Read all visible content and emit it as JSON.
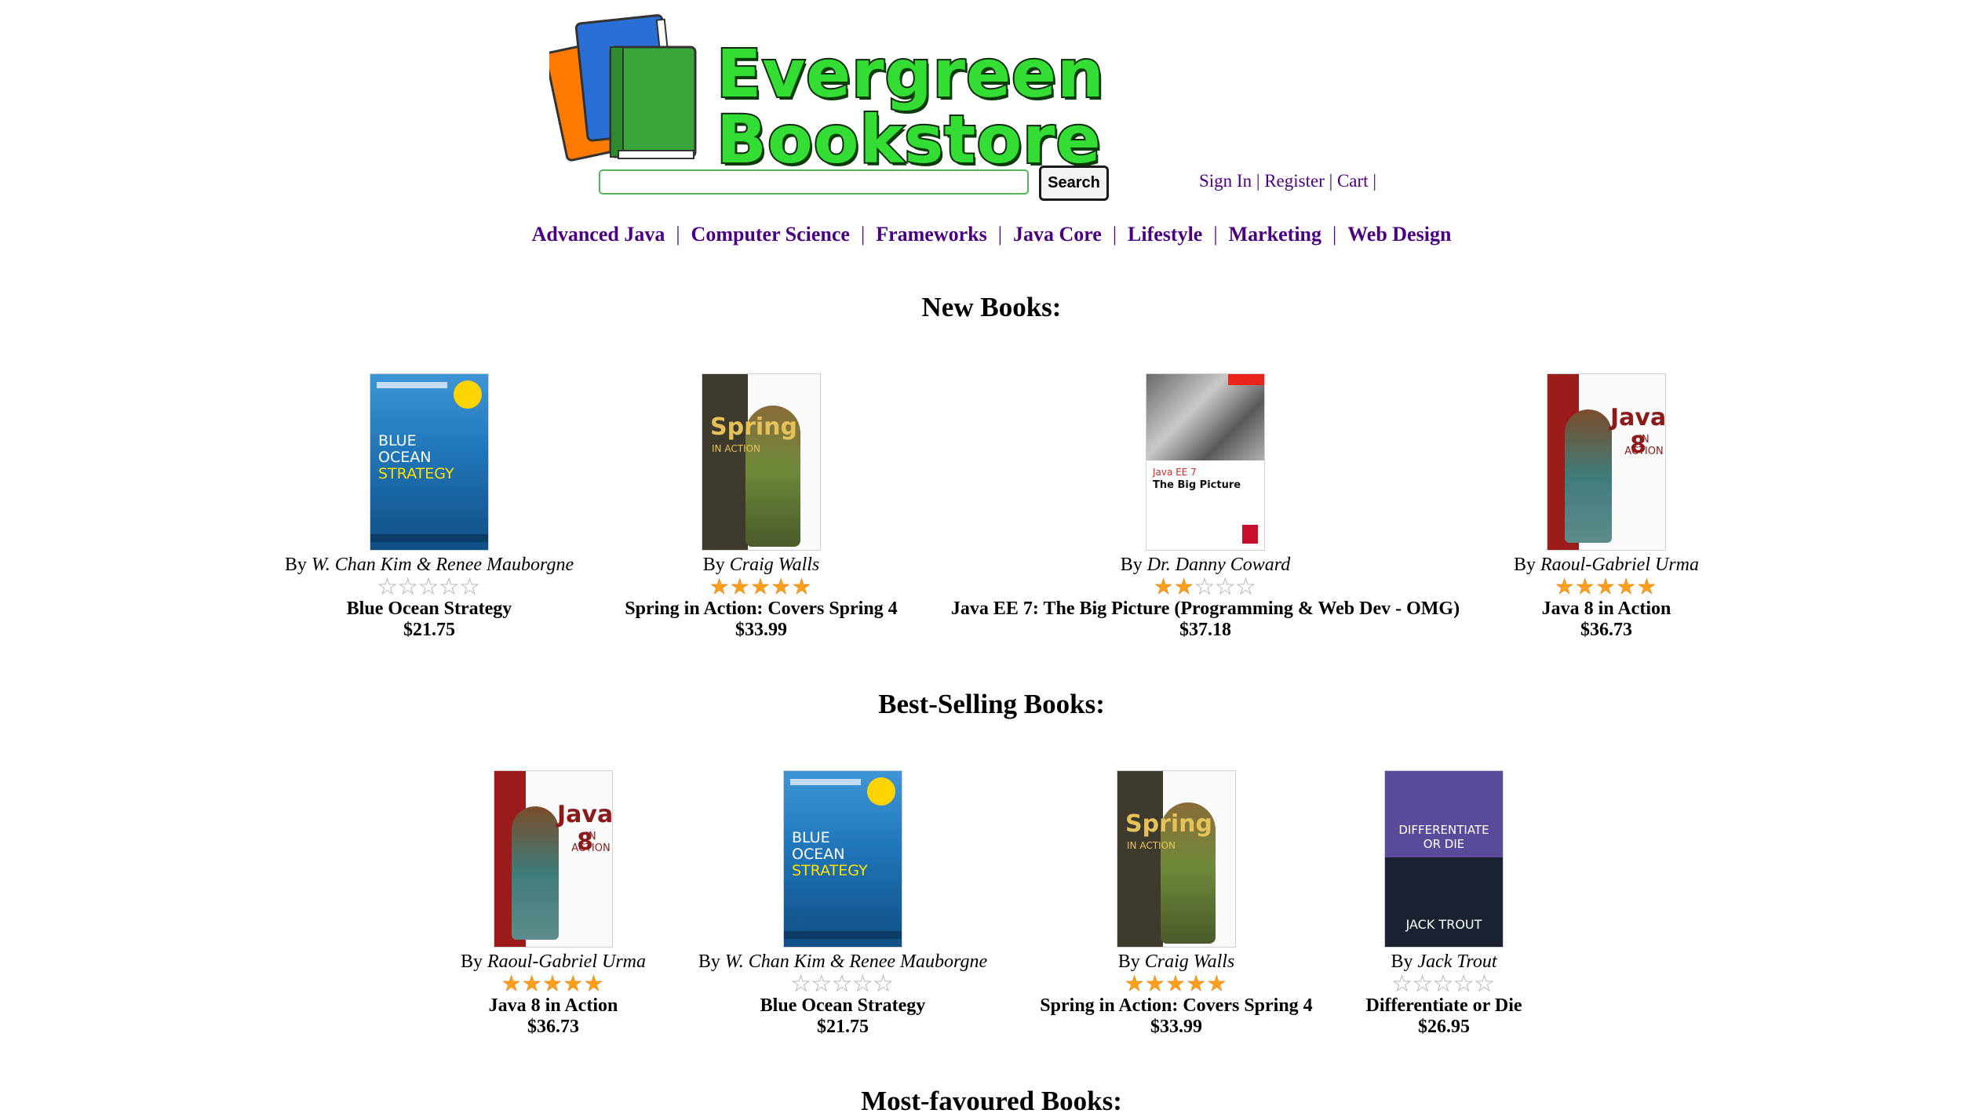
{
  "header": {
    "logo_text": "Evergreen Bookstore",
    "logo_color": "#33dd33"
  },
  "search": {
    "value": "",
    "placeholder": "",
    "button_label": "Search"
  },
  "user_links": {
    "sign_in": "Sign In",
    "register": "Register",
    "cart": "Cart",
    "separator": "|"
  },
  "categories": [
    "Advanced Java",
    "Computer Science",
    "Frameworks",
    "Java Core",
    "Lifestyle",
    "Marketing",
    "Web Design"
  ],
  "nav_separator": "|",
  "sections": {
    "new_books": {
      "title": "New Books:",
      "books": [
        {
          "author": "W. Chan Kim & Renee Mauborgne",
          "rating": 0,
          "title": "Blue Ocean Strategy",
          "price": "$21.75",
          "cover": "blue-ocean",
          "cover_text": {
            "l1": "BLUE",
            "l2": "OCEAN",
            "l3": "STRATEGY"
          }
        },
        {
          "author": "Craig Walls",
          "rating": 5,
          "title": "Spring in Action: Covers Spring 4",
          "price": "$33.99",
          "cover": "spring",
          "cover_text": {
            "l1": "Spring",
            "l2": "IN ACTION"
          }
        },
        {
          "author": "Dr. Danny Coward",
          "rating": 2,
          "title": "Java EE 7: The Big Picture (Programming & Web Dev - OMG)",
          "price": "$37.18",
          "cover": "javaee",
          "cover_text": {
            "l1": "Java EE 7",
            "l2": "The Big Picture"
          }
        },
        {
          "author": "Raoul-Gabriel Urma",
          "rating": 5,
          "title": "Java 8 in Action",
          "price": "$36.73",
          "cover": "java8",
          "cover_text": {
            "l1": "Java 8",
            "l2": "IN ACTION"
          }
        }
      ]
    },
    "best_selling": {
      "title": "Best-Selling Books:",
      "books": [
        {
          "author": "Raoul-Gabriel Urma",
          "rating": 5,
          "title": "Java 8 in Action",
          "price": "$36.73",
          "cover": "java8",
          "cover_text": {
            "l1": "Java 8",
            "l2": "IN ACTION"
          }
        },
        {
          "author": "W. Chan Kim & Renee Mauborgne",
          "rating": 0,
          "title": "Blue Ocean Strategy",
          "price": "$21.75",
          "cover": "blue-ocean",
          "cover_text": {
            "l1": "BLUE",
            "l2": "OCEAN",
            "l3": "STRATEGY"
          }
        },
        {
          "author": "Craig Walls",
          "rating": 5,
          "title": "Spring in Action: Covers Spring 4",
          "price": "$33.99",
          "cover": "spring",
          "cover_text": {
            "l1": "Spring",
            "l2": "IN ACTION"
          }
        },
        {
          "author": "Jack Trout",
          "rating": 0,
          "title": "Differentiate or Die",
          "price": "$26.95",
          "cover": "differentiate",
          "cover_text": {
            "l1": "DIFFERENTIATE",
            "l2": "OR DIE",
            "l3": "JACK TROUT"
          }
        }
      ]
    },
    "most_favoured": {
      "title": "Most-favoured Books:"
    }
  },
  "by_prefix": "By",
  "link_color": "#4b0082",
  "star_on_color": "#ff9f1a",
  "star_icon": "star-icon"
}
